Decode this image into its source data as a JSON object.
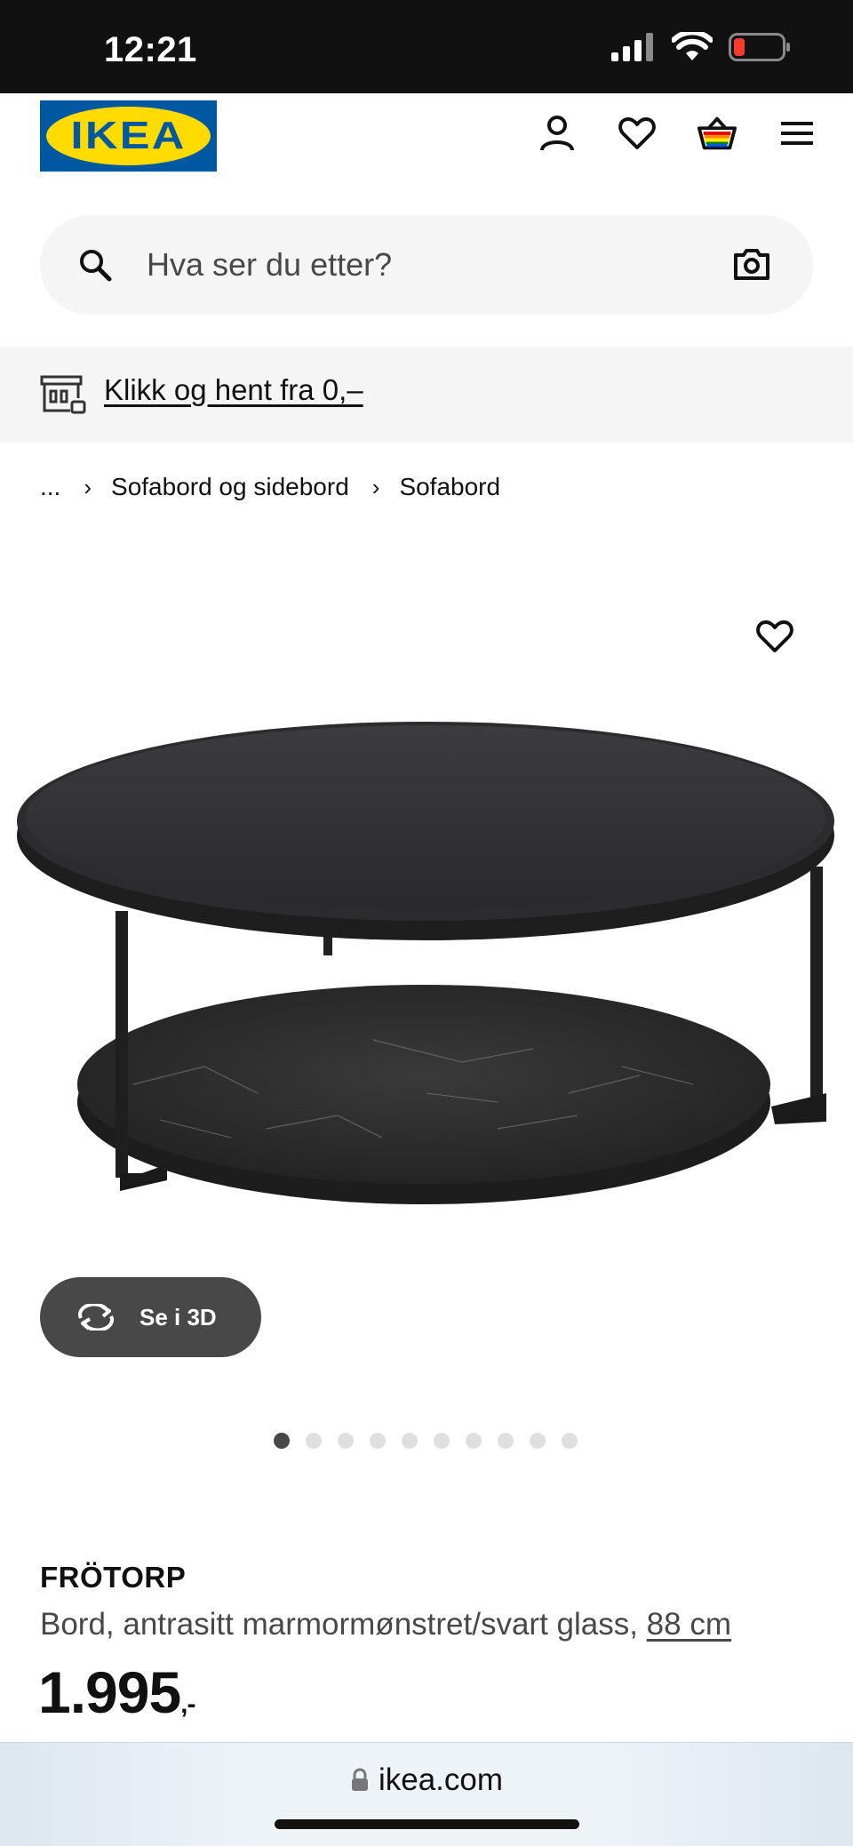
{
  "status_bar": {
    "time": "12:21"
  },
  "header": {
    "logo_text": "IKEA",
    "icons": [
      "account-icon",
      "wishlist-heart-icon",
      "shopping-bag-icon",
      "hamburger-menu-icon"
    ]
  },
  "search": {
    "placeholder": "Hva ser du etter?"
  },
  "banner": {
    "link_text": "Klikk og hent fra 0,–"
  },
  "breadcrumb": {
    "items": [
      "...",
      "Sofabord og sidebord",
      "Sofabord"
    ]
  },
  "product": {
    "button_3d_label": "Se i 3D",
    "image_count": 10,
    "active_image_index": 0,
    "name": "FRÖTORP",
    "description": "Bord, antrasitt marmormønstret/svart glass, ",
    "size_link": "88 cm",
    "price": "1.995",
    "price_suffix": ",-"
  },
  "browser": {
    "url": "ikea.com"
  },
  "colors": {
    "ikea_blue": "#0058a3",
    "ikea_yellow": "#ffdb00",
    "button_dark": "#484848"
  }
}
